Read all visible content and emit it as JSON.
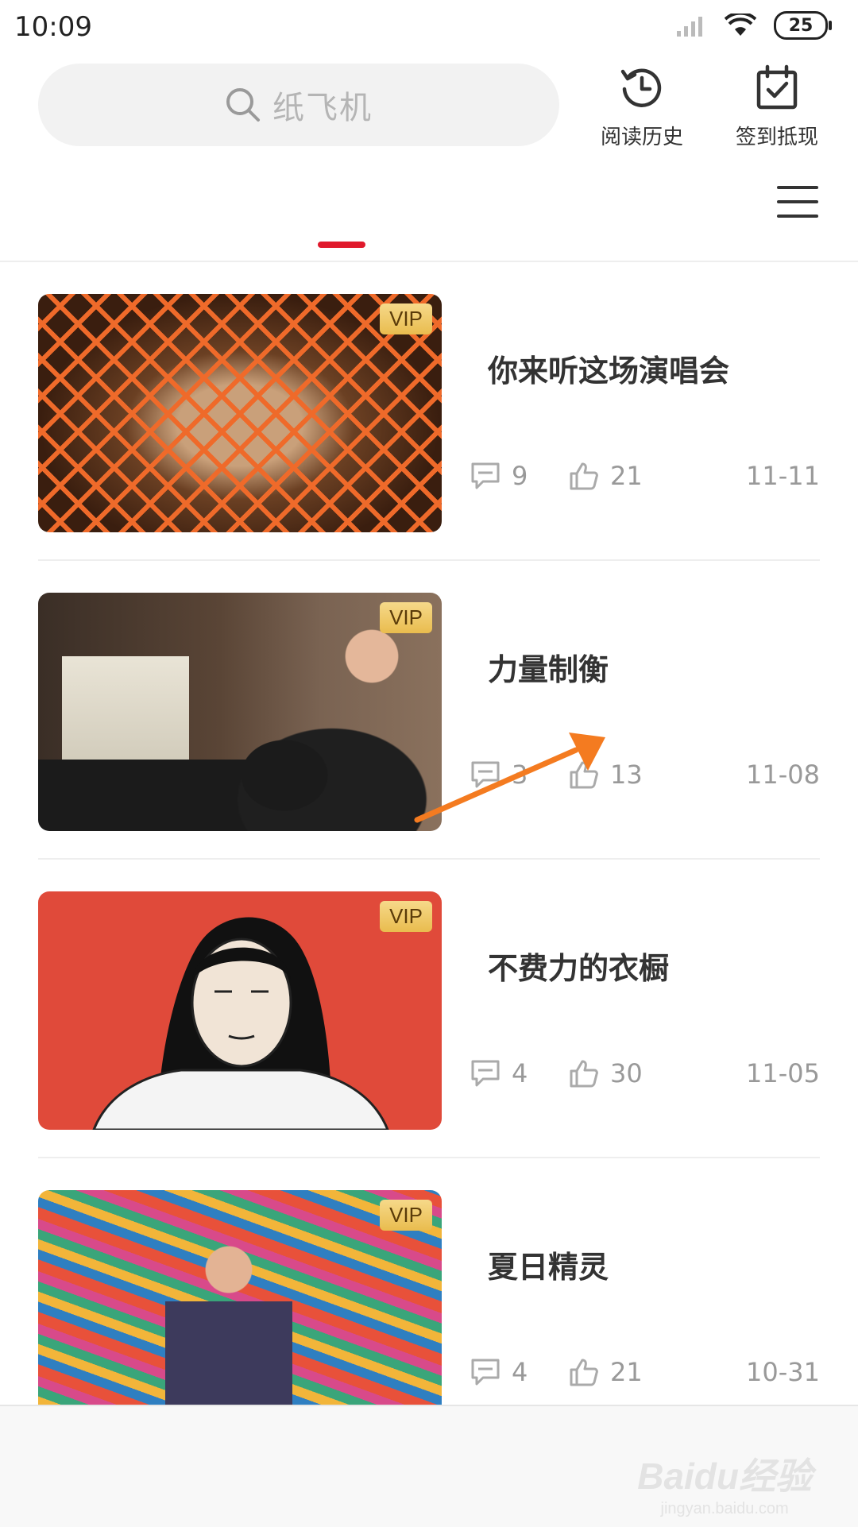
{
  "status_bar": {
    "time": "10:09",
    "battery": "25"
  },
  "header": {
    "search_placeholder": "纸飞机",
    "history_label": "阅读历史",
    "checkin_label": "签到抵现"
  },
  "feed": {
    "badge_label": "VIP",
    "items": [
      {
        "title": "你来听这场演唱会",
        "comments": "9",
        "likes": "21",
        "date": "11-11"
      },
      {
        "title": "力量制衡",
        "comments": "3",
        "likes": "13",
        "date": "11-08"
      },
      {
        "title": "不费力的衣橱",
        "comments": "4",
        "likes": "30",
        "date": "11-05"
      },
      {
        "title": "夏日精灵",
        "comments": "4",
        "likes": "21",
        "date": "10-31"
      }
    ]
  },
  "watermark": {
    "main": "Baidu经验",
    "sub": "jingyan.baidu.com"
  },
  "colors": {
    "accent": "#e0192c",
    "annotation": "#f47b20",
    "vip_gold": "#e9bc4e"
  }
}
